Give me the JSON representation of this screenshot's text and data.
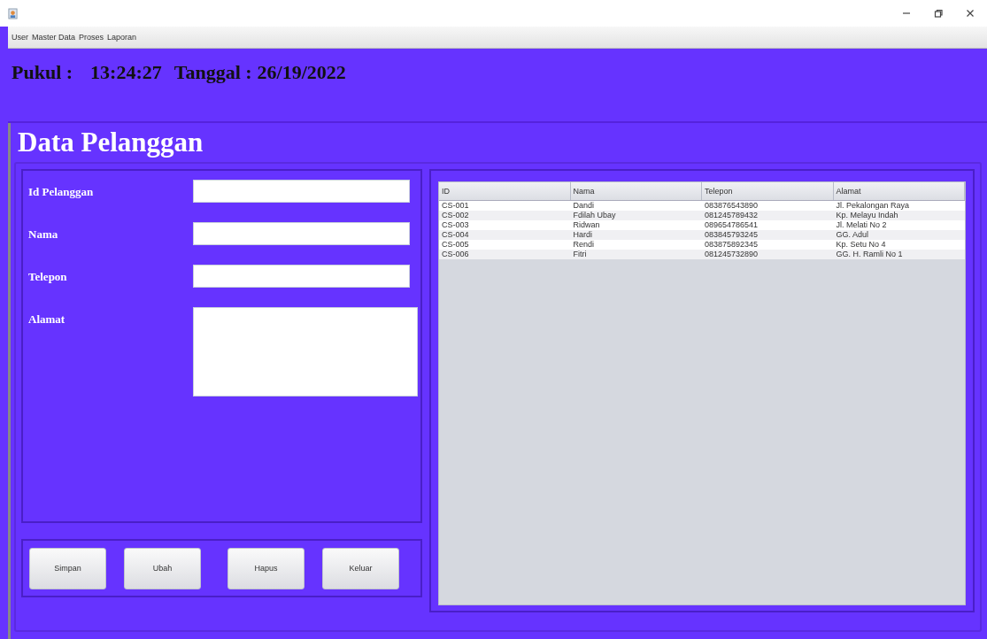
{
  "menu": [
    "User",
    "Master Data",
    "Proses",
    "Laporan"
  ],
  "clock": {
    "time_label": "Pukul :",
    "time": "13:24:27",
    "date_label": "Tanggal :",
    "date": "26/19/2022"
  },
  "title": "Data Pelanggan",
  "form": [
    {
      "label": "Id Pelanggan",
      "kind": "text"
    },
    {
      "label": "Nama",
      "kind": "text"
    },
    {
      "label": "Telepon",
      "kind": "text"
    },
    {
      "label": "Alamat",
      "kind": "area"
    }
  ],
  "buttons": [
    "Simpan",
    "Ubah",
    "Hapus",
    "Keluar"
  ],
  "table": {
    "columns": [
      "ID",
      "Nama",
      "Telepon",
      "Alamat"
    ],
    "rows": [
      [
        "CS-001",
        "Dandi",
        "083876543890",
        "Jl. Pekalongan Raya"
      ],
      [
        "CS-002",
        "Fdilah Ubay",
        "081245789432",
        "Kp. Melayu Indah"
      ],
      [
        "CS-003",
        "Ridwan",
        "089654786541",
        "Jl. Melati No 2"
      ],
      [
        "CS-004",
        "Hardi",
        "083845793245",
        "GG. Adul"
      ],
      [
        "CS-005",
        "Rendi",
        "083875892345",
        "Kp. Setu No 4"
      ],
      [
        "CS-006",
        "Fitri",
        "081245732890",
        "GG. H. Ramli No 1"
      ]
    ]
  }
}
